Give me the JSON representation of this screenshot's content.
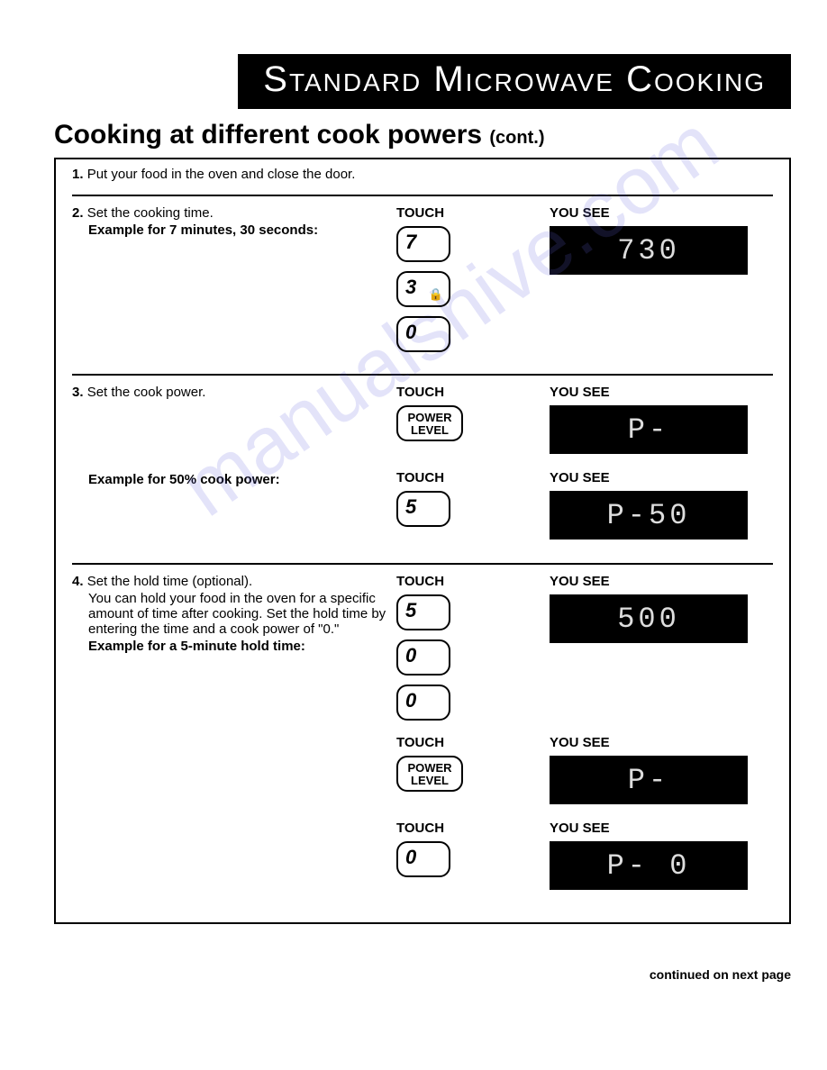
{
  "banner": "Standard Microwave Cooking",
  "title_main": "Cooking at different cook powers ",
  "title_suffix": "(cont.)",
  "watermark": "manualshive.com",
  "labels": {
    "touch": "TOUCH",
    "yousee": "YOU SEE",
    "power_level": "POWER LEVEL"
  },
  "steps": {
    "s1": {
      "num": "1.",
      "text": "Put your food in the oven and close the door."
    },
    "s2": {
      "num": "2.",
      "text": "Set the cooking time.",
      "example": "Example for 7 minutes, 30 seconds:",
      "keys": [
        "7",
        "3",
        "0"
      ],
      "display": "730"
    },
    "s3": {
      "num": "3.",
      "text": "Set the cook power.",
      "display1": "P-",
      "example": "Example for 50% cook power:",
      "key2": "5",
      "display2": "P-50"
    },
    "s4": {
      "num": "4.",
      "text": "Set the hold time (optional).",
      "note": "You can hold your food in the oven for a specific amount of time after cooking. Set the hold time by entering the time and a cook power of \"0.\"",
      "example": "Example for a 5-minute hold time:",
      "keys1": [
        "5",
        "0",
        "0"
      ],
      "display1": "500",
      "display2": "P-",
      "key3": "0",
      "display3": "P- 0"
    }
  },
  "footer": "continued on next page"
}
